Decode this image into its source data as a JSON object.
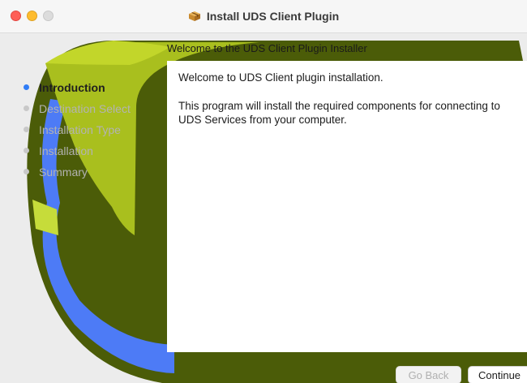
{
  "window": {
    "title": "Install UDS Client Plugin",
    "title_icon": "package-icon"
  },
  "subtitle": "Welcome to the UDS Client Plugin Installer",
  "steps": [
    {
      "label": "Introduction",
      "active": true
    },
    {
      "label": "Destination Select",
      "active": false
    },
    {
      "label": "Installation Type",
      "active": false
    },
    {
      "label": "Installation",
      "active": false
    },
    {
      "label": "Summary",
      "active": false
    }
  ],
  "content": {
    "welcome": "Welcome to UDS Client plugin installation.",
    "description": "This program will install the required components for connecting to UDS Services from your computer."
  },
  "buttons": {
    "back": "Go Back",
    "continue": "Continue"
  },
  "colors": {
    "logo_green": "#a9bf1e",
    "logo_dark": "#4b5c08",
    "logo_blue": "#4d7bf6",
    "active_step": "#2f7cf6"
  }
}
